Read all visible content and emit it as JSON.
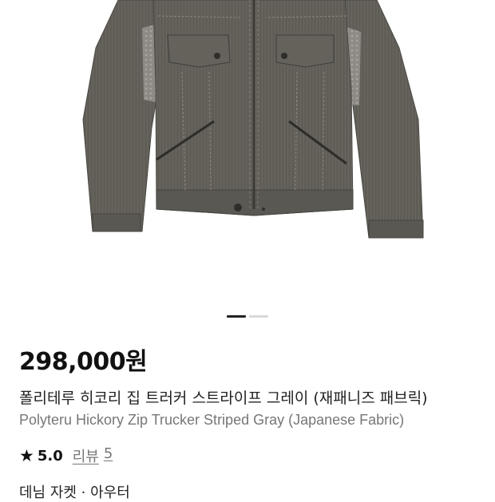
{
  "product": {
    "image_alt": "Polyteru Hickory Zip Trucker jacket product photo",
    "price": "298,000원",
    "title_ko": "폴리테루 히코리 집 트러커 스트라이프 그레이 (재패니즈 패브릭)",
    "title_en": "Polyteru Hickory Zip Trucker Striped Gray (Japanese Fabric)",
    "rating": {
      "score": "5.0",
      "reviews_label": "리뷰",
      "reviews_count": "5"
    },
    "category": "데님 자켓 · 아우터"
  },
  "carousel": {
    "total": 2,
    "active_index": 1
  },
  "icons": {
    "star": "star-icon"
  }
}
